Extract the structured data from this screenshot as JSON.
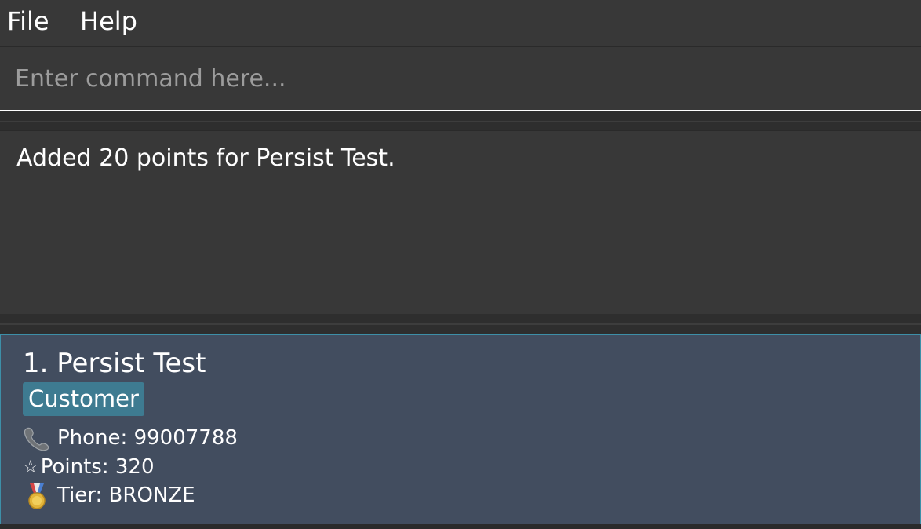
{
  "menubar": {
    "items": [
      "File",
      "Help"
    ]
  },
  "command_box": {
    "placeholder": "Enter command here...",
    "value": ""
  },
  "result_display": {
    "message": "Added 20 points for Persist Test."
  },
  "person_list": {
    "cards": [
      {
        "index_name": "1. Persist Test",
        "tags": [
          "Customer"
        ],
        "phone_label": "Phone: 99007788",
        "points_label": "Points: 320",
        "tier_label": "Tier: BRONZE",
        "icons": {
          "phone": "phone-icon",
          "points": "star-icon",
          "tier": "medal-icon"
        }
      }
    ]
  },
  "colors": {
    "menubar_bg": "#383838",
    "panel_bg": "#383838",
    "card_bg": "#424d5f",
    "card_border": "#3d8fa8",
    "tag_bg": "#3e7b91",
    "placeholder_text": "#9c9c9c"
  }
}
